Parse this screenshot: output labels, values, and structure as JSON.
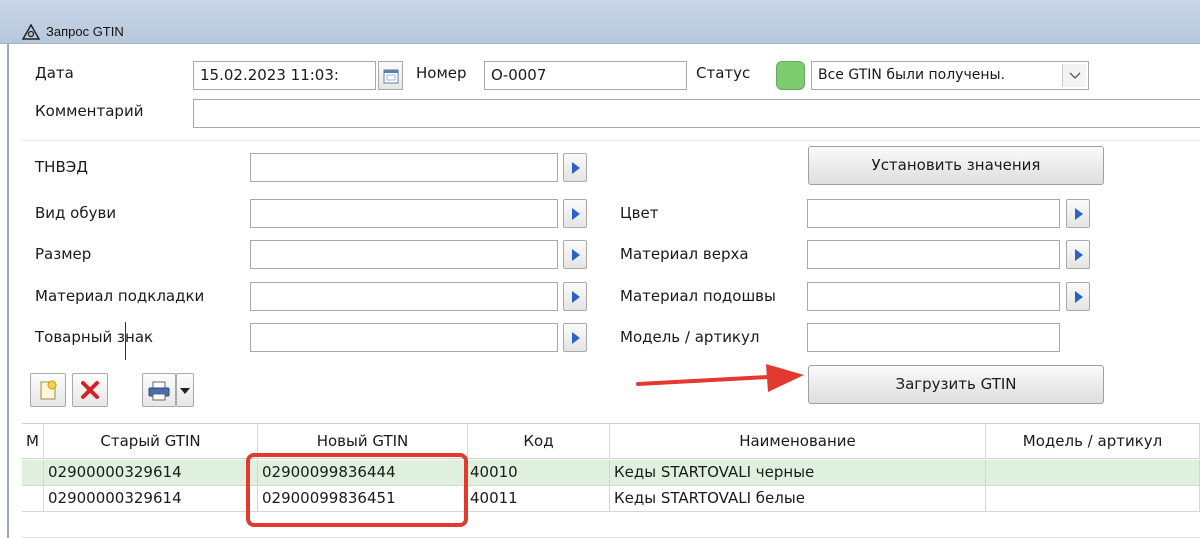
{
  "window": {
    "title": "Запрос GTIN"
  },
  "header": {
    "date_label": "Дата",
    "date_value": "15.02.2023 11:03:",
    "number_label": "Номер",
    "number_value": "О-0007",
    "status_label": "Статус",
    "status_value": "Все GTIN были получены.",
    "status_color": "#7ccd6e",
    "comment_label": "Комментарий",
    "comment_value": ""
  },
  "filters": {
    "tnved_label": "ТНВЭД",
    "shoe_type_label": "Вид обуви",
    "size_label": "Размер",
    "lining_label": "Материал подкладки",
    "trademark_label": "Товарный знак",
    "color_label": "Цвет",
    "upper_label": "Материал верха",
    "sole_label": "Материал подошвы",
    "model_label": "Модель / артикул"
  },
  "buttons": {
    "set_values": "Установить значения",
    "load_gtin": "Загрузить GTIN"
  },
  "table": {
    "columns": [
      "М",
      "Старый GTIN",
      "Новый GTIN",
      "Код",
      "Наименование",
      "Модель / артикул"
    ],
    "rows": [
      {
        "old_gtin": "02900000329614",
        "new_gtin": "02900099836444",
        "code": "40010",
        "name": "Кеды STARTOVALI черные",
        "model": ""
      },
      {
        "old_gtin": "02900000329614",
        "new_gtin": "02900099836451",
        "code": "40011",
        "name": "Кеды STARTOVALI белые",
        "model": ""
      }
    ]
  },
  "colors": {
    "accent_row": "#dff0df",
    "highlight_box": "#e23a2f",
    "arrow": "#e23a2f"
  }
}
